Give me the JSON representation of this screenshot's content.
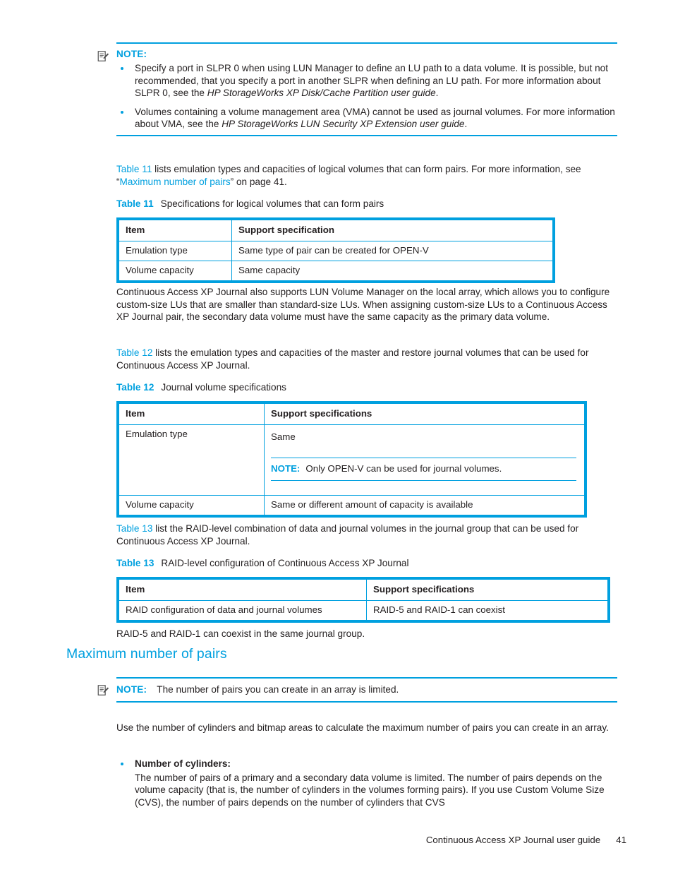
{
  "note_top": {
    "icon": "note-pad-icon",
    "label": "NOTE:",
    "bullets": [
      {
        "pre": "Specify a port in SLPR 0 when using LUN Manager to define an LU path to a data volume. It is possible, but not recommended, that you specify a port in another SLPR when defining an LU path. For more information about SLPR 0, see the ",
        "italic": "HP StorageWorks XP Disk/Cache Partition user guide",
        "post": "."
      },
      {
        "pre": "Volumes containing a volume management area (VMA) cannot be used as journal volumes. For more information about VMA, see the ",
        "italic": "HP StorageWorks LUN Security XP Extension user guide",
        "post": "."
      }
    ]
  },
  "intro_t11": {
    "link1": "Table 11",
    "text1": " lists emulation types and capacities of logical volumes that can form pairs. For more information, see “",
    "link2": "Maximum number of pairs",
    "text2": "” on page 41."
  },
  "table11": {
    "caption_label": "Table 11",
    "caption_text": "Specifications for logical volumes that can form pairs",
    "headers": [
      "Item",
      "Support specification"
    ],
    "rows": [
      [
        "Emulation type",
        "Same type of pair can be created for OPEN-V"
      ],
      [
        "Volume capacity",
        "Same capacity"
      ]
    ]
  },
  "para_lun": "Continuous Access XP Journal also supports LUN Volume Manager on the local array, which allows you to configure custom-size LUs that are smaller than standard-size LUs. When assigning custom-size LUs to a Continuous Access XP Journal pair, the secondary data volume must have the same capacity as the primary data volume.",
  "intro_t12": {
    "link1": "Table 12",
    "text1": " lists the emulation types and capacities of the master and restore journal volumes that can be used for Continuous Access XP Journal."
  },
  "table12": {
    "caption_label": "Table 12",
    "caption_text": "Journal volume specifications",
    "headers": [
      "Item",
      "Support specifications"
    ],
    "row1_item": "Emulation type",
    "row1_value": "Same",
    "row1_note_label": "NOTE:",
    "row1_note_text": "Only OPEN-V can be used for journal volumes.",
    "row2_item": "Volume capacity",
    "row2_value": "Same or different amount of capacity is available"
  },
  "intro_t13": {
    "link1": "Table 13",
    "text1": " list the RAID-level combination of data and journal volumes in the journal group that can be used for Continuous Access XP Journal."
  },
  "table13": {
    "caption_label": "Table 13",
    "caption_text": "RAID-level configuration of Continuous Access XP Journal",
    "headers": [
      "Item",
      "Support specifications"
    ],
    "rows": [
      [
        "RAID configuration of data and journal volumes",
        "RAID-5 and RAID-1 can coexist"
      ]
    ]
  },
  "para_raid": "RAID-5 and RAID-1 can coexist in the same journal group.",
  "heading_max_pairs": "Maximum number of pairs",
  "note_pairs": {
    "icon": "note-pad-icon",
    "label": "NOTE:",
    "text": "The number of pairs you can create in an array is limited."
  },
  "para_use_cylinders": "Use the number of cylinders and bitmap areas to calculate the maximum number of pairs you can create in an array.",
  "bullet_cylinders": {
    "title": "Number of cylinders:",
    "text": "The number of pairs of a primary and a secondary data volume is limited. The number of pairs depends on the volume capacity (that is, the number of cylinders in the volumes forming pairs). If you use Custom Volume Size (CVS), the number of pairs depends on the number of cylinders that CVS"
  },
  "footer": {
    "title": "Continuous Access XP Journal user guide",
    "page": "41"
  },
  "colors": {
    "accent": "#00a0df",
    "text": "#231f20"
  }
}
